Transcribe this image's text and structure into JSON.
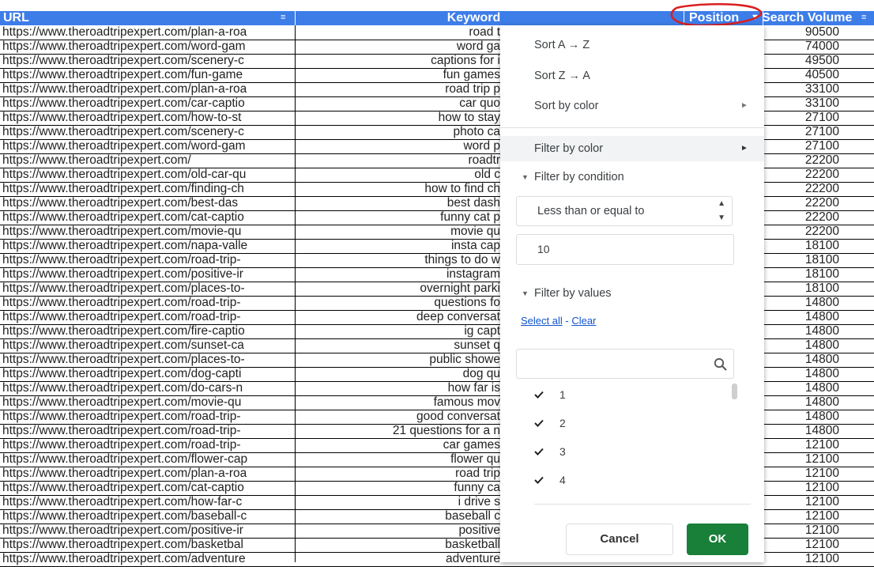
{
  "headers": {
    "url": "URL",
    "keyword": "Keyword",
    "position": "Position",
    "volume": "Search Volume"
  },
  "rows": [
    {
      "url": "https://www.theroadtripexpert.com/plan-a-roa",
      "kw": "road t",
      "vol": "90500"
    },
    {
      "url": "https://www.theroadtripexpert.com/word-gam",
      "kw": "word ga",
      "vol": "74000"
    },
    {
      "url": "https://www.theroadtripexpert.com/scenery-c",
      "kw": "captions for i",
      "vol": "49500"
    },
    {
      "url": "https://www.theroadtripexpert.com/fun-game",
      "kw": "fun games",
      "vol": "40500"
    },
    {
      "url": "https://www.theroadtripexpert.com/plan-a-roa",
      "kw": "road trip p",
      "vol": "33100"
    },
    {
      "url": "https://www.theroadtripexpert.com/car-captio",
      "kw": "car quo",
      "vol": "33100"
    },
    {
      "url": "https://www.theroadtripexpert.com/how-to-st",
      "kw": "how to stay",
      "vol": "27100"
    },
    {
      "url": "https://www.theroadtripexpert.com/scenery-c",
      "kw": "photo ca",
      "vol": "27100"
    },
    {
      "url": "https://www.theroadtripexpert.com/word-gam",
      "kw": "word p",
      "vol": "27100"
    },
    {
      "url": "https://www.theroadtripexpert.com/",
      "kw": "roadtr",
      "vol": "22200"
    },
    {
      "url": "https://www.theroadtripexpert.com/old-car-qu",
      "kw": "old c",
      "vol": "22200"
    },
    {
      "url": "https://www.theroadtripexpert.com/finding-ch",
      "kw": "how to find ch",
      "vol": "22200"
    },
    {
      "url": "https://www.theroadtripexpert.com/best-das",
      "kw": "best dash",
      "vol": "22200"
    },
    {
      "url": "https://www.theroadtripexpert.com/cat-captio",
      "kw": "funny cat p",
      "vol": "22200"
    },
    {
      "url": "https://www.theroadtripexpert.com/movie-qu",
      "kw": "movie qu",
      "vol": "22200"
    },
    {
      "url": "https://www.theroadtripexpert.com/napa-valle",
      "kw": "insta cap",
      "vol": "18100"
    },
    {
      "url": "https://www.theroadtripexpert.com/road-trip-",
      "kw": "things to do w",
      "vol": "18100"
    },
    {
      "url": "https://www.theroadtripexpert.com/positive-ir",
      "kw": "instagram",
      "vol": "18100"
    },
    {
      "url": "https://www.theroadtripexpert.com/places-to-",
      "kw": "overnight parki",
      "vol": "18100"
    },
    {
      "url": "https://www.theroadtripexpert.com/road-trip-",
      "kw": "questions fo",
      "vol": "14800"
    },
    {
      "url": "https://www.theroadtripexpert.com/road-trip-",
      "kw": "deep conversat",
      "vol": "14800"
    },
    {
      "url": "https://www.theroadtripexpert.com/fire-captio",
      "kw": "ig capt",
      "vol": "14800"
    },
    {
      "url": "https://www.theroadtripexpert.com/sunset-ca",
      "kw": "sunset q",
      "vol": "14800"
    },
    {
      "url": "https://www.theroadtripexpert.com/places-to-",
      "kw": "public showe",
      "vol": "14800"
    },
    {
      "url": "https://www.theroadtripexpert.com/dog-capti",
      "kw": "dog qu",
      "vol": "14800"
    },
    {
      "url": "https://www.theroadtripexpert.com/do-cars-n",
      "kw": "how far is",
      "vol": "14800"
    },
    {
      "url": "https://www.theroadtripexpert.com/movie-qu",
      "kw": "famous mov",
      "vol": "14800"
    },
    {
      "url": "https://www.theroadtripexpert.com/road-trip-",
      "kw": "good conversat",
      "vol": "14800"
    },
    {
      "url": "https://www.theroadtripexpert.com/road-trip-",
      "kw": "21 questions for a n",
      "vol": "14800"
    },
    {
      "url": "https://www.theroadtripexpert.com/road-trip-",
      "kw": "car games",
      "vol": "12100"
    },
    {
      "url": "https://www.theroadtripexpert.com/flower-cap",
      "kw": "flower qu",
      "vol": "12100"
    },
    {
      "url": "https://www.theroadtripexpert.com/plan-a-roa",
      "kw": "road trip",
      "vol": "12100"
    },
    {
      "url": "https://www.theroadtripexpert.com/cat-captio",
      "kw": "funny ca",
      "vol": "12100"
    },
    {
      "url": "https://www.theroadtripexpert.com/how-far-c",
      "kw": "i drive s",
      "vol": "12100"
    },
    {
      "url": "https://www.theroadtripexpert.com/baseball-c",
      "kw": "baseball c",
      "vol": "12100"
    },
    {
      "url": "https://www.theroadtripexpert.com/positive-ir",
      "kw": "positive",
      "vol": "12100"
    },
    {
      "url": "https://www.theroadtripexpert.com/basketbal",
      "kw": "basketball",
      "vol": "12100"
    },
    {
      "url": "https://www.theroadtripexpert.com/adventure",
      "kw": "adventure",
      "vol": "12100"
    }
  ],
  "menu": {
    "sort_az": "Sort A → Z",
    "sort_za": "Sort Z → A",
    "sort_color": "Sort by color",
    "filter_color": "Filter by color",
    "filter_condition": "Filter by condition",
    "condition_value": "Less than or equal to",
    "condition_input": "10",
    "filter_values": "Filter by values",
    "select_all": "Select all",
    "link_sep": " - ",
    "clear": "Clear",
    "values": [
      "1",
      "2",
      "3",
      "4"
    ],
    "cancel": "Cancel",
    "ok": "OK"
  },
  "colors": {
    "header_bg": "#3d7de8",
    "ok_bg": "#188038",
    "annotation": "#d92020"
  }
}
